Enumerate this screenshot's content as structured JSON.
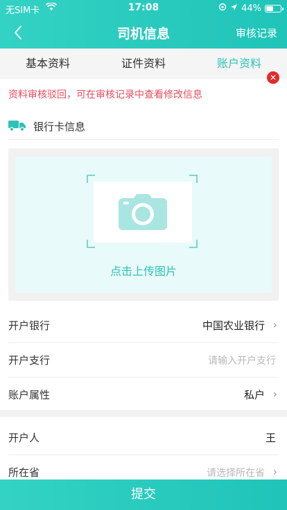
{
  "status_bar": {
    "carrier": "无SIM卡",
    "time": "17:08",
    "battery": "44%",
    "battery_level": 0.44
  },
  "nav": {
    "title": "司机信息",
    "action": "审核记录"
  },
  "tabs": [
    {
      "label": "基本资料",
      "active": false
    },
    {
      "label": "证件资料",
      "active": false
    },
    {
      "label": "账户资料",
      "active": true
    }
  ],
  "notice": "资料审核驳回，可在审核记录中查看修改信息",
  "bank_section": {
    "label": "银行卡信息"
  },
  "upload": {
    "label": "点击上传图片"
  },
  "fields": {
    "bank": {
      "label": "开户银行",
      "value": "中国农业银行"
    },
    "branch": {
      "label": "开户支行",
      "placeholder": "请输入开户支行"
    },
    "account_type": {
      "label": "账户属性",
      "value": "私户"
    },
    "holder": {
      "label": "开户人",
      "value": "王"
    },
    "province": {
      "label": "所在省",
      "placeholder": "请选择所在省"
    }
  },
  "submit": {
    "label": "提交"
  },
  "colors": {
    "primary": "#2ec2b7",
    "notice": "#e84c5b",
    "delete": "#e22b2b"
  }
}
